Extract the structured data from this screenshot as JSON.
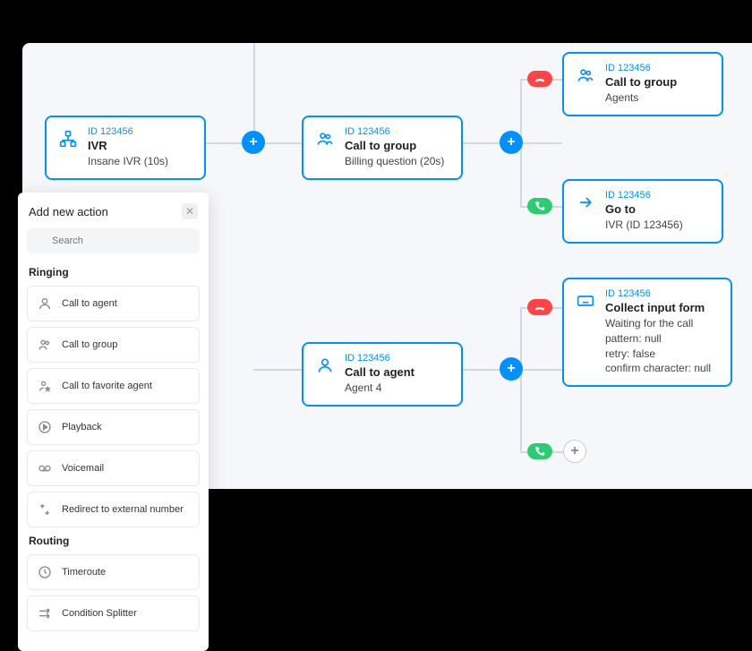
{
  "panel": {
    "title": "Add new action",
    "search_placeholder": "Search",
    "sections": [
      {
        "label": "Ringing",
        "items": [
          {
            "icon": "agent",
            "label": "Call to agent"
          },
          {
            "icon": "group",
            "label": "Call to group"
          },
          {
            "icon": "favorite-agent",
            "label": "Call to favorite agent"
          },
          {
            "icon": "playback",
            "label": "Playback"
          },
          {
            "icon": "voicemail",
            "label": "Voicemail"
          },
          {
            "icon": "redirect",
            "label": "Redirect to external number"
          }
        ]
      },
      {
        "label": "Routing",
        "items": [
          {
            "icon": "clock",
            "label": "Timeroute"
          },
          {
            "icon": "splitter",
            "label": "Condition Splitter"
          }
        ]
      }
    ]
  },
  "nodes": {
    "ivr": {
      "id": "ID 123456",
      "title": "IVR",
      "subtitle": "Insane IVR (10s)"
    },
    "billing": {
      "id": "ID 123456",
      "title": "Call to group",
      "subtitle": "Billing question (20s)"
    },
    "agents": {
      "id": "ID 123456",
      "title": "Call to group",
      "subtitle": "Agents"
    },
    "goto": {
      "id": "ID 123456",
      "title": "Go to",
      "subtitle": "IVR (ID 123456)"
    },
    "collect": {
      "id": "ID 123456",
      "title": "Collect input form",
      "subtitle": "Waiting for the call\npattern: null\nretry: false\nconfirm character: null"
    },
    "agent4": {
      "id": "ID 123456",
      "title": "Call to agent",
      "subtitle": "Agent 4"
    }
  }
}
